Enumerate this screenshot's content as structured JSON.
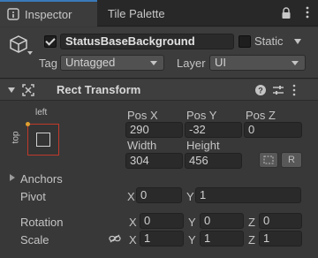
{
  "tabs": [
    {
      "label": "Inspector"
    },
    {
      "label": "Tile Palette"
    }
  ],
  "header": {
    "object_name": "StatusBaseBackground",
    "active": true,
    "static_label": "Static",
    "static_checked": false,
    "tag_label": "Tag",
    "tag_value": "Untagged",
    "layer_label": "Layer",
    "layer_value": "UI"
  },
  "rect_transform": {
    "title": "Rect Transform",
    "anchor_preset": {
      "horizontal": "left",
      "vertical": "top"
    },
    "pos_x_label": "Pos X",
    "pos_y_label": "Pos Y",
    "pos_z_label": "Pos Z",
    "pos_x": "290",
    "pos_y": "-32",
    "pos_z": "0",
    "width_label": "Width",
    "height_label": "Height",
    "width": "304",
    "height": "456",
    "raw_button": "R",
    "anchors_label": "Anchors",
    "pivot_label": "Pivot",
    "pivot_x": "0",
    "pivot_y": "1",
    "rotation_label": "Rotation",
    "rotation": {
      "x": "0",
      "y": "0",
      "z": "0"
    },
    "scale_label": "Scale",
    "scale": {
      "x": "1",
      "y": "1",
      "z": "1"
    },
    "axis_x": "X",
    "axis_y": "Y",
    "axis_z": "Z"
  },
  "colors": {
    "panel_bg": "#383838",
    "tab_bar": "#282828",
    "active_tab_accent": "#3a79bb",
    "field_bg": "#2a2a2a",
    "anchor_red": "#c0392b"
  },
  "icons": [
    "inspector-icon",
    "lock-icon",
    "kebab-menu-icon",
    "gameobject-cube-icon",
    "help-icon",
    "presets-icon",
    "rect-transform-icon",
    "link-icon",
    "blueprint-mode-icon"
  ]
}
